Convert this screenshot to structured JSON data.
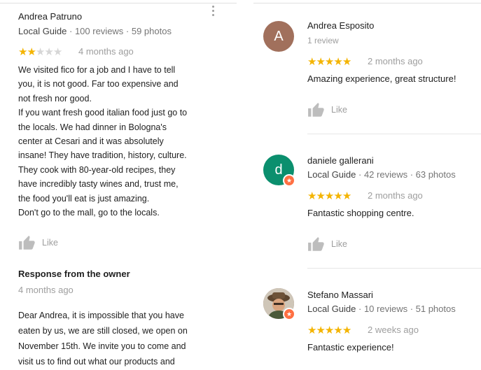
{
  "left_review": {
    "author": "Andrea Patruno",
    "meta_guide": "Local Guide",
    "meta_counts": " · 100 reviews · 59 photos",
    "rating": 2,
    "age": "4 months ago",
    "text_lines": [
      "We visited fico for a job and I have to tell",
      "you, it is not good. Far too expensive and",
      "not fresh nor good.",
      "If you want fresh good italian food just go to",
      "the locals. We had dinner in Bologna's",
      "center at Cesari and it was absolutely",
      "insane! They have tradition, history, culture.",
      "They cook with 80-year-old recipes, they",
      "have incredibly tasty wines and, trust me,",
      "the food you'll eat is just amazing.",
      "Don't go to the mall, go to the locals."
    ],
    "like_label": "Like",
    "owner_response": {
      "heading": "Response from the owner",
      "age": "4 months ago",
      "text_lines": [
        "Dear Andrea, it is impossible that you have",
        "eaten by us, we are still closed, we open on",
        "November 15th. We invite you to come and",
        "visit us to find out what our products and"
      ]
    }
  },
  "right_reviews": [
    {
      "author": "Andrea Esposito",
      "avatar_letter": "A",
      "avatar_color": "#a1705c",
      "meta": "1 review",
      "rating": 5,
      "age": "2 months ago",
      "text": "Amazing experience, great structure!",
      "like_label": "Like"
    },
    {
      "author": "daniele gallerani",
      "avatar_letter": "d",
      "avatar_color": "#0b8f6e",
      "meta_guide": "Local Guide",
      "meta_counts": " · 42 reviews · 63 photos",
      "rating": 5,
      "age": "2 months ago",
      "text": "Fantastic shopping centre.",
      "like_label": "Like"
    },
    {
      "author": "Stefano Massari",
      "meta_guide": "Local Guide",
      "meta_counts": " · 10 reviews · 51 photos",
      "rating": 5,
      "age": "2 weeks ago",
      "text": "Fantastic experience!"
    }
  ],
  "colors": {
    "star": "#f4b400",
    "star_empty": "#d6d6d6",
    "badge": "#ff7043"
  },
  "icons": [
    "thumbs-up-icon",
    "more-vert-icon",
    "local-guide-badge-icon",
    "star-icon"
  ]
}
